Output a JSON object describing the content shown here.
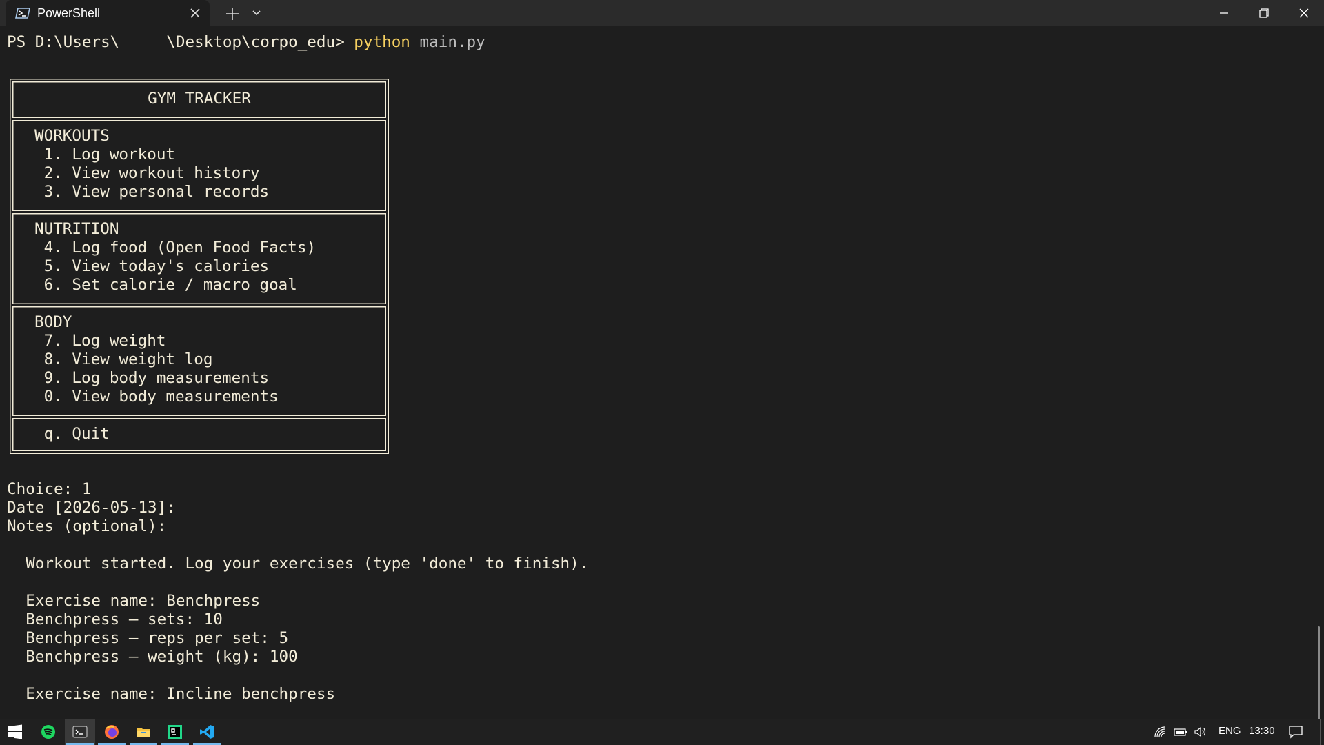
{
  "tab": {
    "title": "PowerShell"
  },
  "terminal": {
    "prompt": "PS D:\\Users\\     \\Desktop\\corpo_edu> ",
    "command": "python",
    "argument": " main.py",
    "menu": {
      "title": "GYM TRACKER",
      "sections": [
        {
          "heading": "WORKOUTS",
          "items": [
            " 1. Log workout",
            " 2. View workout history",
            " 3. View personal records"
          ]
        },
        {
          "heading": "NUTRITION",
          "items": [
            " 4. Log food (Open Food Facts)",
            " 5. View today's calories",
            " 6. Set calorie / macro goal"
          ]
        },
        {
          "heading": "BODY",
          "items": [
            " 7. Log weight",
            " 8. View weight log",
            " 9. Log body measurements",
            " 0. View body measurements"
          ]
        }
      ],
      "quit": " q. Quit"
    },
    "output": [
      "Choice: 1",
      "Date [2026-05-13]:",
      "Notes (optional):",
      "",
      "  Workout started. Log your exercises (type 'done' to finish).",
      "",
      "  Exercise name: Benchpress",
      "  Benchpress — sets: 10",
      "  Benchpress — reps per set: 5",
      "  Benchpress — weight (kg): 100",
      "",
      "  Exercise name: Incline benchpress"
    ]
  },
  "taskbar": {
    "apps": [
      "windows-start",
      "spotify",
      "terminal",
      "firefox",
      "file-explorer",
      "pycharm",
      "vscode"
    ],
    "tray": {
      "language": "ENG",
      "time": "13:30"
    }
  }
}
